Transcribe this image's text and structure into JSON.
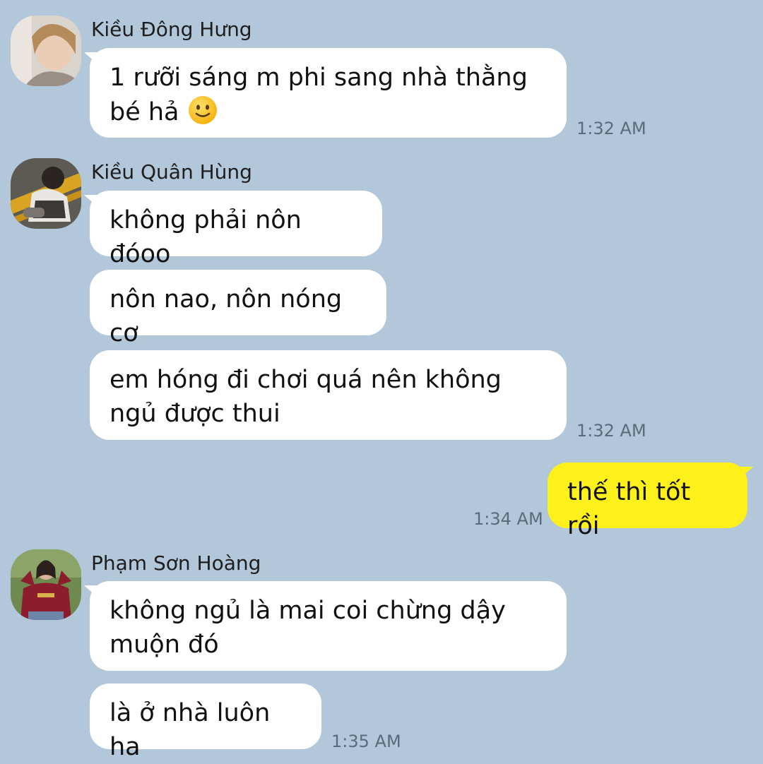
{
  "chat": {
    "messages": [
      {
        "sender": "Kiều Đông Hưng",
        "text_line1": "1 rưỡi sáng m phi sang nhà thằng",
        "text_line2": "bé hả",
        "emoji": "slightly-smiling-face",
        "time": "1:32 AM"
      },
      {
        "sender": "Kiều Quân Hùng",
        "bubbles": [
          "không phải nôn đóoo",
          "nôn nao, nôn nóng cơ",
          "em hóng đi chơi quá nên không ngủ được thui"
        ],
        "time": "1:32 AM"
      },
      {
        "sender": "me",
        "text": "thế thì tốt rồi",
        "time": "1:34 AM"
      },
      {
        "sender": "Phạm Sơn Hoàng",
        "bubbles": [
          "không ngủ là mai coi chừng dậy muộn đó",
          "là ở nhà luôn ha"
        ],
        "time": "1:35 AM"
      }
    ]
  },
  "colors": {
    "background": "#b2c7da",
    "incoming_bubble": "#ffffff",
    "outgoing_bubble": "#fef01b",
    "timestamp": "#5a6b7a"
  }
}
